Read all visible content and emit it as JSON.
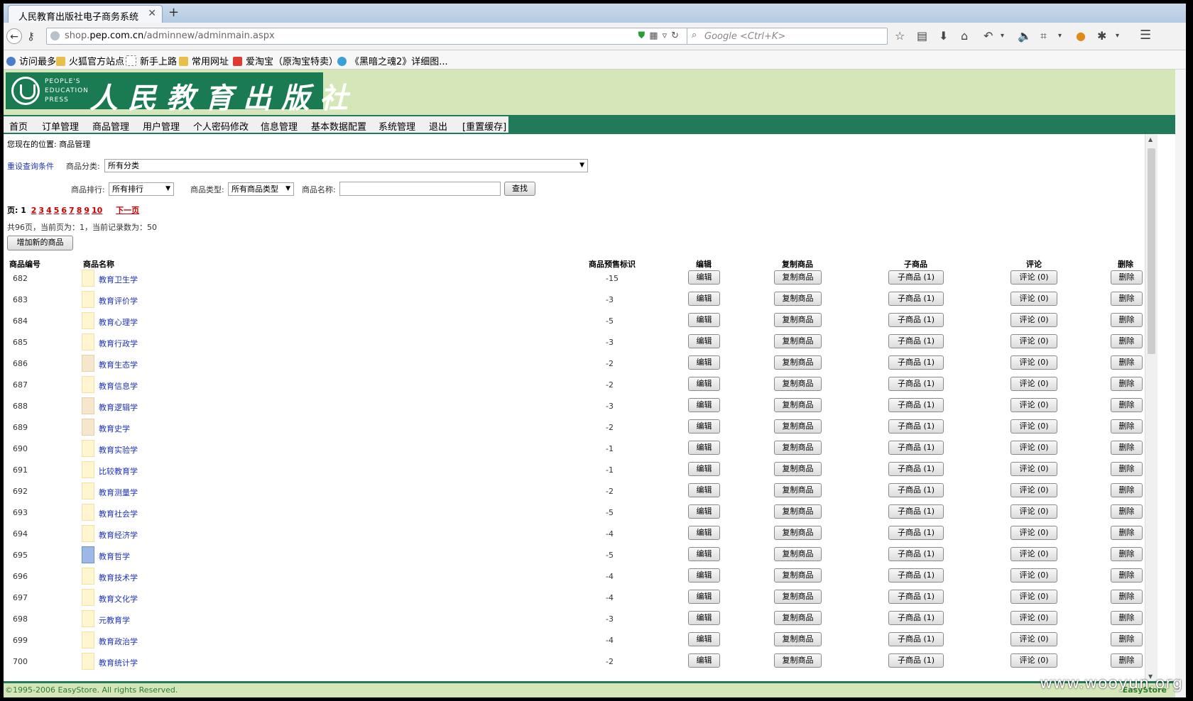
{
  "browser": {
    "tab_title": "人民教育出版社电子商务系统",
    "url_prefix": "shop.",
    "url_domain": "pep.com.cn",
    "url_path": "/adminnew/adminmain.aspx",
    "search_placeholder": "Google <Ctrl+K>",
    "bookmarks": [
      "访问最多",
      "火狐官方站点",
      "新手上路",
      "常用网址",
      "爱淘宝（原淘宝特卖）",
      "《黑暗之魂2》详细图..."
    ]
  },
  "header": {
    "logo_en": [
      "PEOPLE'S",
      "EDUCATION",
      "PRESS"
    ],
    "logo_cn": "人民教育出版社"
  },
  "menu": [
    "首页",
    "订单管理",
    "商品管理",
    "用户管理",
    "个人密码修改",
    "信息管理",
    "基本数据配置",
    "系统管理",
    "退出",
    "[重置缓存]"
  ],
  "breadcrumb": "您现在的位置: 商品管理",
  "filters": {
    "reset_label": "重设查询条件",
    "category_label": "商品分类:",
    "category_value": "所有分类",
    "sort_label": "商品排行:",
    "sort_value": "所有排行",
    "type_label": "商品类型:",
    "type_value": "所有商品类型",
    "name_label": "商品名称:",
    "name_value": "",
    "search_button": "查找"
  },
  "pager": {
    "prefix": "页:",
    "current": "1",
    "pages": [
      "2",
      "3",
      "4",
      "5",
      "6",
      "7",
      "8",
      "9",
      "10"
    ],
    "next": "下一页",
    "summary": "共96页，当前页为：1，当前记录数为：50"
  },
  "add_button": "增加新的商品",
  "table": {
    "headers": [
      "商品编号",
      "商品名称",
      "商品预售标识",
      "编辑",
      "复制商品",
      "子商品",
      "评论",
      "删除"
    ],
    "edit_label": "编辑",
    "copy_label": "复制商品",
    "sub_label": "子商品 (1)",
    "comment_label": "评论 (0)",
    "delete_label": "删除",
    "rows": [
      {
        "id": "682",
        "name": "教育卫生学",
        "presale": "-15"
      },
      {
        "id": "683",
        "name": "教育评价学",
        "presale": "-3"
      },
      {
        "id": "684",
        "name": "教育心理学",
        "presale": "-5"
      },
      {
        "id": "685",
        "name": "教育行政学",
        "presale": "-3"
      },
      {
        "id": "686",
        "name": "教育生态学",
        "presale": "-2"
      },
      {
        "id": "687",
        "name": "教育信息学",
        "presale": "-2"
      },
      {
        "id": "688",
        "name": "教育逻辑学",
        "presale": "-3"
      },
      {
        "id": "689",
        "name": "教育史学",
        "presale": "-2"
      },
      {
        "id": "690",
        "name": "教育实验学",
        "presale": "-1"
      },
      {
        "id": "691",
        "name": "比较教育学",
        "presale": "-1"
      },
      {
        "id": "692",
        "name": "教育测量学",
        "presale": "-2"
      },
      {
        "id": "693",
        "name": "教育社会学",
        "presale": "-5"
      },
      {
        "id": "694",
        "name": "教育经济学",
        "presale": "-4"
      },
      {
        "id": "695",
        "name": "教育哲学",
        "presale": "-5"
      },
      {
        "id": "696",
        "name": "教育技术学",
        "presale": "-4"
      },
      {
        "id": "697",
        "name": "教育文化学",
        "presale": "-4"
      },
      {
        "id": "698",
        "name": "元教育学",
        "presale": "-3"
      },
      {
        "id": "699",
        "name": "教育政治学",
        "presale": "-4"
      },
      {
        "id": "700",
        "name": "教育统计学",
        "presale": "-2"
      }
    ]
  },
  "footer": {
    "copyright": "©1995-2006 EasyStore. All rights Reserved.",
    "brand": "EasyStore"
  },
  "watermark": "www.wooyun.org"
}
